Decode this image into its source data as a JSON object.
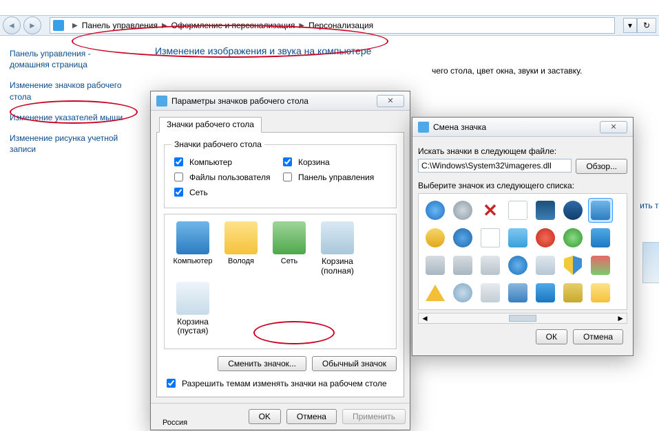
{
  "breadcrumbs": {
    "a": "Панель управления",
    "b": "Оформление и персонализация",
    "c": "Персонализация"
  },
  "sidebar": {
    "home1": "Панель управления -",
    "home2": "домашняя страница",
    "link1a": "Изменение значков рабочего",
    "link1b": "стола",
    "link2": "Изменение указателей мыши",
    "link3a": "Изменение рисунка учетной",
    "link3b": "записи"
  },
  "content": {
    "heading": "Изменение изображения и звука на компьютере",
    "subtext_tail": "чего стола, цвет окна, звуки и заставку.",
    "region": "Россия",
    "sidetext": "ить те"
  },
  "dlg1": {
    "title": "Параметры значков рабочего стола",
    "tab": "Значки рабочего стола",
    "group_legend": "Значки рабочего стола",
    "chk_computer": "Компьютер",
    "chk_userfiles": "Файлы пользователя",
    "chk_network": "Сеть",
    "chk_recycle": "Корзина",
    "chk_cpanel": "Панель управления",
    "icons": {
      "computer": "Компьютер",
      "volodya": "Володя",
      "network": "Сеть",
      "recycle_full1": "Корзина",
      "recycle_full2": "(полная)",
      "recycle_empty1": "Корзина",
      "recycle_empty2": "(пустая)"
    },
    "btn_change": "Сменить значок...",
    "btn_default": "Обычный значок",
    "allow_themes": "Разрешить темам изменять значки на рабочем столе",
    "ok": "OK",
    "cancel": "Отмена",
    "apply": "Применить"
  },
  "dlg2": {
    "title": "Смена значка",
    "search_label": "Искать значки в следующем файле:",
    "path": "C:\\Windows\\System32\\imageres.dll",
    "browse": "Обзор...",
    "select_label": "Выберите значок из следующего списка:",
    "ok": "ОК",
    "cancel": "Отмена"
  }
}
